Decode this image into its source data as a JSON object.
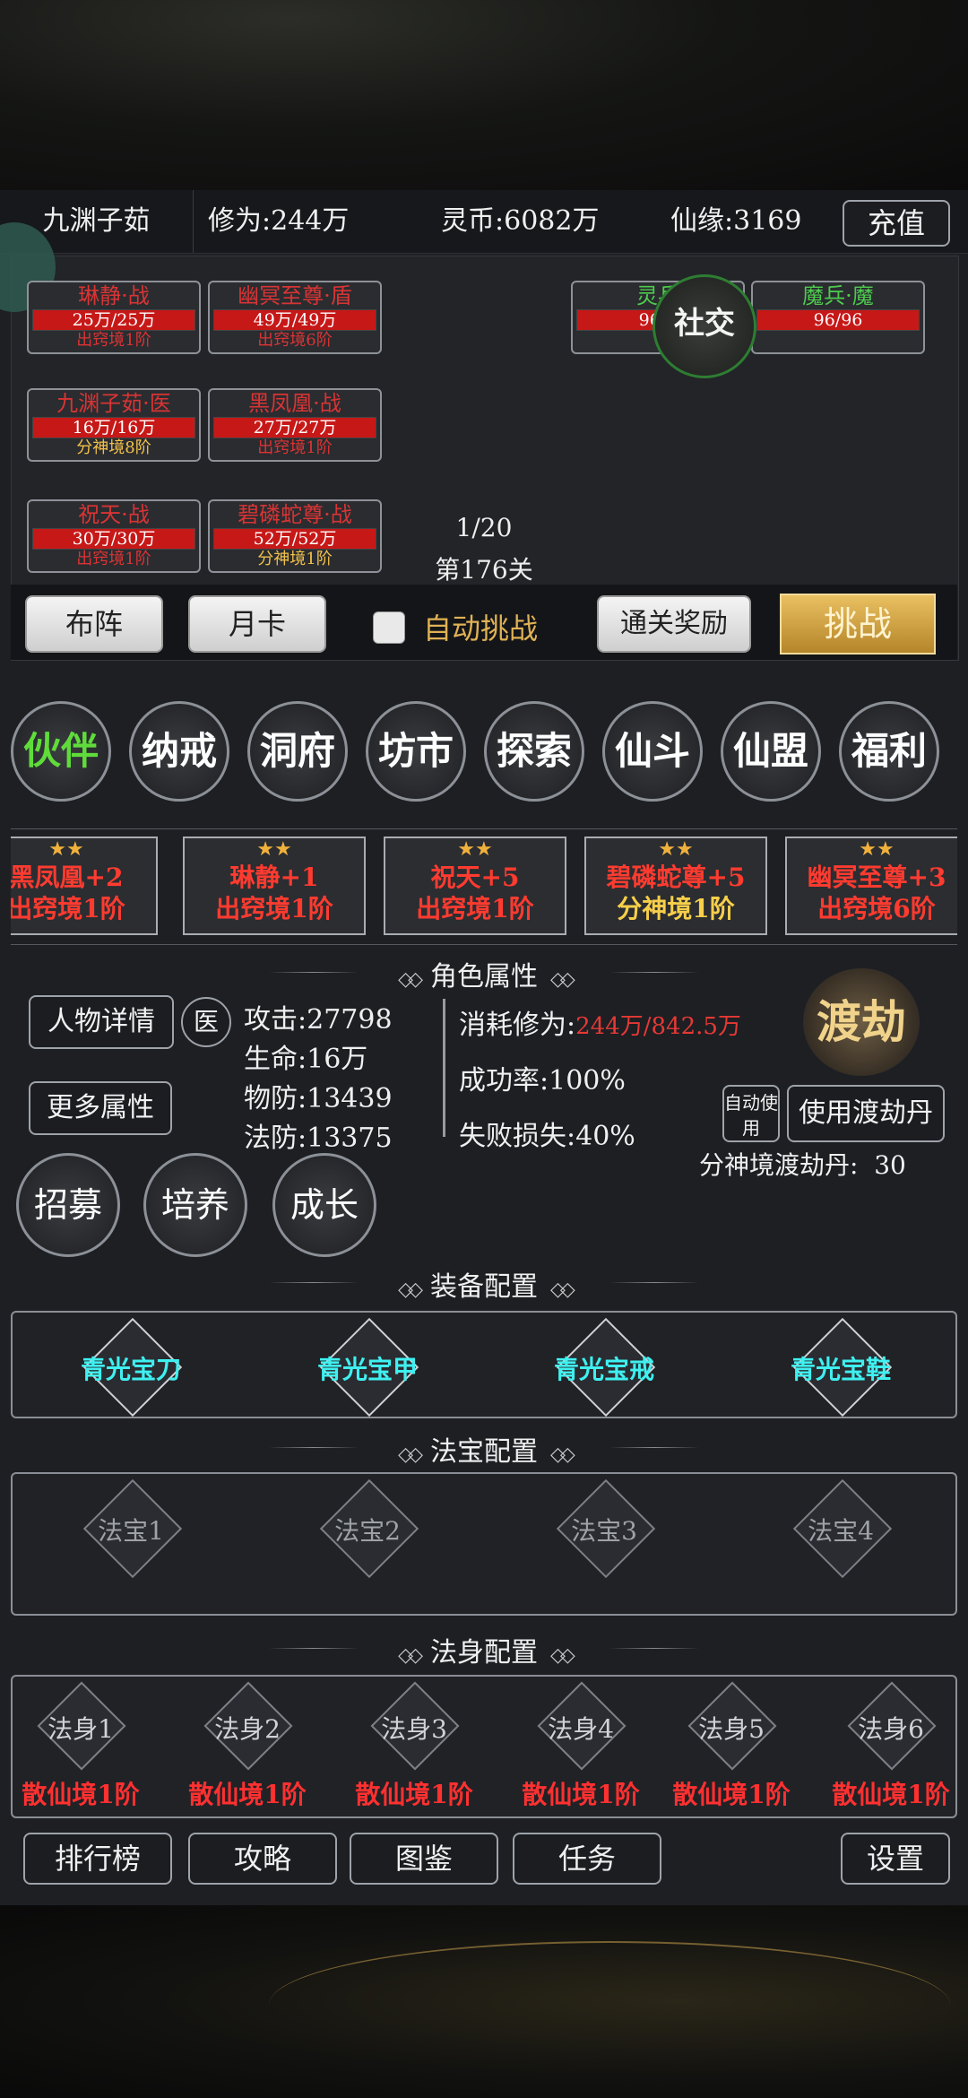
{
  "header": {
    "name": "九渊子茹",
    "cultivation": "修为:244万",
    "coins": "灵币:6082万",
    "fate": "仙缘:3169",
    "recharge_label": "充值"
  },
  "battle": {
    "allies": [
      {
        "title": "琳静·战",
        "hp": "25万/25万",
        "rank": "出窍境1阶"
      },
      {
        "title": "幽冥至尊·盾",
        "hp": "49万/49万",
        "rank": "出窍境6阶"
      },
      {
        "title": "九渊子茹·医",
        "hp": "16万/16万",
        "rank": "分神境8阶"
      },
      {
        "title": "黑凤凰·战",
        "hp": "27万/27万",
        "rank": "出窍境1阶"
      },
      {
        "title": "祝天·战",
        "hp": "30万/30万",
        "rank": "出窍境1阶"
      },
      {
        "title": "碧磷蛇尊·战",
        "hp": "52万/52万",
        "rank": "分神境1阶"
      }
    ],
    "enemies": [
      {
        "title": "灵兵",
        "hp": "96/9"
      },
      {
        "title": "魔兵·魔",
        "hp": "96/96"
      }
    ],
    "social_label": "社交",
    "progress": "1/20",
    "stage": "第176关"
  },
  "actions": {
    "formation": "布阵",
    "monthly_card": "月卡",
    "auto_challenge": "自动挑战",
    "clear_reward": "通关奖励",
    "challenge": "挑战"
  },
  "menu": [
    "伙伴",
    "纳戒",
    "洞府",
    "坊市",
    "探索",
    "仙斗",
    "仙盟",
    "福利"
  ],
  "partners": [
    {
      "stars": "★★",
      "name": "黑凤凰+2",
      "rank": "出窍境1阶"
    },
    {
      "stars": "★★",
      "name": "琳静+1",
      "rank": "出窍境1阶"
    },
    {
      "stars": "★★",
      "name": "祝天+5",
      "rank": "出窍境1阶"
    },
    {
      "stars": "★★",
      "name": "碧磷蛇尊+5",
      "rank": "分神境1阶"
    },
    {
      "stars": "★★",
      "name": "幽冥至尊+3",
      "rank": "出窍境6阶"
    }
  ],
  "attributes": {
    "section_title": "角色属性",
    "detail_button": "人物详情",
    "class_badge": "医",
    "more_button": "更多属性",
    "attack": "攻击:27798",
    "life": "生命:16万",
    "phys_def": "物防:13439",
    "magic_def": "法防:13375",
    "cost_label": "消耗修为:",
    "cost_value": "244万/842.5万",
    "success_rate": "成功率:100%",
    "fail_loss": "失败损失:40%",
    "dujie_label": "渡劫",
    "auto_use": "自动使用",
    "use_pill": "使用渡劫丹",
    "pill_count": "分神境渡劫丹:  30"
  },
  "growth": [
    "招募",
    "培养",
    "成长"
  ],
  "equipment": {
    "section_title": "装备配置",
    "items": [
      "青光宝刀",
      "青光宝甲",
      "青光宝戒",
      "青光宝鞋"
    ]
  },
  "treasures": {
    "section_title": "法宝配置",
    "items": [
      "法宝1",
      "法宝2",
      "法宝3",
      "法宝4"
    ]
  },
  "bodies": {
    "section_title": "法身配置",
    "items": [
      {
        "name": "法身1",
        "rank": "散仙境1阶"
      },
      {
        "name": "法身2",
        "rank": "散仙境1阶"
      },
      {
        "name": "法身3",
        "rank": "散仙境1阶"
      },
      {
        "name": "法身4",
        "rank": "散仙境1阶"
      },
      {
        "name": "法身5",
        "rank": "散仙境1阶"
      },
      {
        "name": "法身6",
        "rank": "散仙境1阶"
      }
    ]
  },
  "footer": {
    "ranking": "排行榜",
    "guide": "攻略",
    "codex": "图鉴",
    "tasks": "任务",
    "settings": "设置"
  }
}
